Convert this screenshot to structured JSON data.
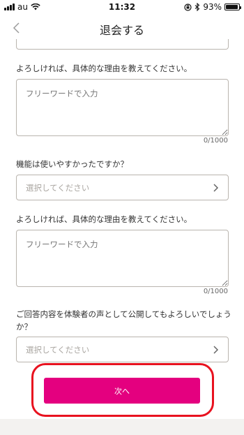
{
  "status_bar": {
    "carrier": "au",
    "time": "11:32",
    "battery": "93%",
    "battery_level": 0.93,
    "icons": [
      "signal-icon",
      "wifi-icon",
      "orientation-lock-icon",
      "bluetooth-icon",
      "battery-icon"
    ]
  },
  "nav": {
    "title": "退会する",
    "back_icon": "chevron-left-icon"
  },
  "form": {
    "reason_label_1": "よろしければ、具体的な理由を教えてください。",
    "textarea_1_placeholder": "フリーワードで入力",
    "counter_1": "0/1000",
    "usability_label": "機能は使いやすかったですか？",
    "select_1_value": "選択してください",
    "reason_label_2": "よろしければ、具体的な理由を教えてください。",
    "textarea_2_placeholder": "フリーワードで入力",
    "counter_2": "0/1000",
    "publish_label": "ご回答内容を体験者の声として公開してもよろしいでしょうか？",
    "select_2_value": "選択してください"
  },
  "actions": {
    "next_label": "次へ"
  },
  "colors": {
    "accent": "#e4007f",
    "highlight": "#e8121f",
    "border": "#b9b4ae",
    "placeholder": "#b7b3ae"
  }
}
